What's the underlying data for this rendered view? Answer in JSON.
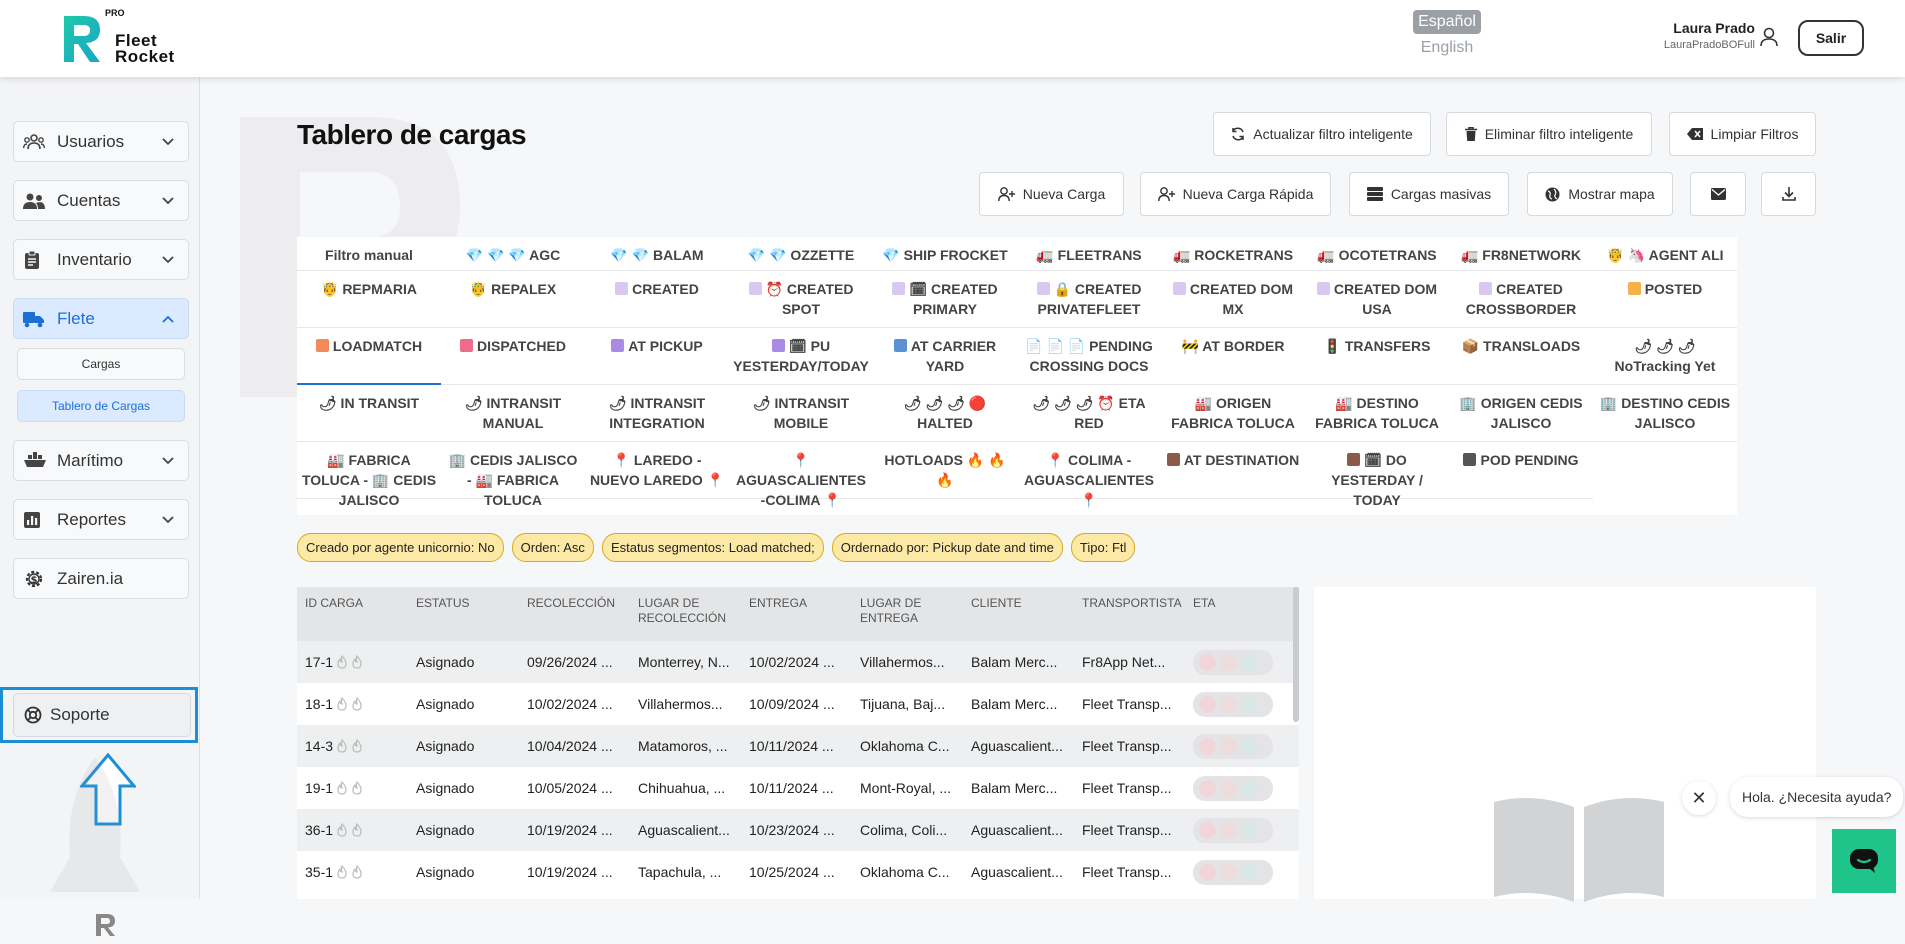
{
  "header": {
    "logo_pro": "PRO",
    "logo_line1": "Fleet",
    "logo_line2": "Rocket",
    "lang_active": "Español",
    "lang_other": "English",
    "user_name": "Laura Prado",
    "user_handle": "LauraPradoBOFull",
    "logout_label": "Salir"
  },
  "sidebar": {
    "items": [
      {
        "label": "Usuarios",
        "icon": "users-icon"
      },
      {
        "label": "Cuentas",
        "icon": "people-icon"
      },
      {
        "label": "Inventario",
        "icon": "clipboard-icon"
      },
      {
        "label": "Flete",
        "icon": "truck-icon"
      },
      {
        "label": "Marítimo",
        "icon": "ship-icon"
      },
      {
        "label": "Reportes",
        "icon": "chart-icon"
      },
      {
        "label": "Zairen.ia",
        "icon": "gear-dollar-icon"
      }
    ],
    "sub_items": [
      "Cargas",
      "Tablero de Cargas"
    ],
    "support_label": "Soporte"
  },
  "main": {
    "title": "Tablero de cargas",
    "buttons": {
      "refresh_filter": "Actualizar filtro inteligente",
      "delete_filter": "Eliminar filtro inteligente",
      "clear_filters": "Limpiar Filtros",
      "new_load": "Nueva Carga",
      "new_quick_load": "Nueva Carga Rápida",
      "bulk_loads": "Cargas masivas",
      "show_map": "Mostrar mapa"
    },
    "filter_rows": [
      [
        "Filtro manual",
        "💎 💎 💎 AGC",
        "💎 💎 BALAM",
        "💎 💎 OZZETTE",
        "💎 SHIP FROCKET",
        "🚛 FLEETRANS",
        "🚛 ROCKETRANS",
        "🚛 OCOTETRANS",
        "🚛 FR8NETWORK",
        "🤴 🦄 AGENT ALI"
      ],
      [
        "🤴 REPMARIA",
        "🤴 REPALEX",
        "▫ CREATED",
        "▫ ⏰ CREATED SPOT",
        "▫ 🗓 CREATED PRIMARY",
        "▫ 🔒 CREATED PRIVATEFLEET",
        "▫ CREATED DOM MX",
        "▫ CREATED DOM USA",
        "▫ CREATED CROSSBORDER",
        "▫ POSTED"
      ],
      [
        "▫ LOADMATCH",
        "▫ DISPATCHED",
        "▫ AT PICKUP",
        "▫ 🗓 PU YESTERDAY/TODAY",
        "▫ AT CARRIER YARD",
        "📄 📄 📄 PENDING CROSSING DOCS",
        "🚧 AT BORDER",
        "🚦 TRANSFERS",
        "📦 TRANSLOADS",
        "🌶 🌶 🌶 NoTracking Yet"
      ],
      [
        "🌶 IN TRANSIT",
        "🌶 INTRANSIT MANUAL",
        "🌶 INTRANSIT INTEGRATION",
        "🌶 INTRANSIT MOBILE",
        "🌶 🌶 🌶 🔴 HALTED",
        "🌶 🌶 🌶 ⏰ ETA RED",
        "🏭 ORIGEN FABRICA TOLUCA",
        "🏭 DESTINO FABRICA TOLUCA",
        "🏢 ORIGEN CEDIS JALISCO",
        "🏢 DESTINO CEDIS JALISCO"
      ],
      [
        "🏭 FABRICA TOLUCA - 🏢 CEDIS JALISCO",
        "🏢 CEDIS JALISCO - 🏭 FABRICA TOLUCA",
        "📍 LAREDO - NUEVO LAREDO 📍",
        "📍 AGUASCALIENTES -COLIMA 📍",
        "HOTLOADS 🔥 🔥 🔥",
        "📍 COLIMA - AGUASCALIENTES 📍",
        "▫ AT DESTINATION",
        "▫ 🗓 DO YESTERDAY / TODAY",
        "▫ POD PENDING"
      ]
    ],
    "status_colors": {
      "created": "#d9c8f0",
      "posted": "#f5b24a",
      "loadmatch": "#f28b5b",
      "dispatched": "#ee6b8a",
      "at_pickup": "#a98ae6",
      "pu_yesterday": "#a98ae6",
      "at_carrier_yard": "#5b8fd6",
      "at_destination": "#8a5a4a",
      "do_yesterday": "#8a5a4a",
      "pod_pending": "#555555"
    },
    "active_tags": [
      "Creado por agente unicornio: No",
      "Orden: Asc",
      "Estatus segmentos: Load matched;",
      "Ordernado por: Pickup date and time",
      "Tipo: Ftl"
    ],
    "table": {
      "columns": [
        "ID CARGA",
        "ESTATUS",
        "RECOLECCIÓN",
        "LUGAR DE RECOLECCIÓN",
        "ENTREGA",
        "LUGAR DE ENTREGA",
        "CLIENTE",
        "TRANSPORTISTA",
        "ETA"
      ],
      "rows": [
        [
          "17-1",
          "Asignado",
          "09/26/2024 ...",
          "Monterrey, N...",
          "10/02/2024 ...",
          "Villahermos...",
          "Balam Merc...",
          "Fr8App Net..."
        ],
        [
          "18-1",
          "Asignado",
          "10/02/2024 ...",
          "Villahermos...",
          "10/09/2024 ...",
          "Tijuana, Baj...",
          "Balam Merc...",
          "Fleet Transp..."
        ],
        [
          "14-3",
          "Asignado",
          "10/04/2024 ...",
          "Matamoros, ...",
          "10/11/2024 ...",
          "Oklahoma C...",
          "Aguascalient...",
          "Fleet Transp..."
        ],
        [
          "19-1",
          "Asignado",
          "10/05/2024 ...",
          "Chihuahua, ...",
          "10/11/2024 ...",
          "Mont-Royal, ...",
          "Balam Merc...",
          "Fleet Transp..."
        ],
        [
          "36-1",
          "Asignado",
          "10/19/2024 ...",
          "Aguascalient...",
          "10/23/2024 ...",
          "Colima, Coli...",
          "Aguascalient...",
          "Fleet Transp..."
        ],
        [
          "35-1",
          "Asignado",
          "10/19/2024 ...",
          "Tapachula, ...",
          "10/25/2024 ...",
          "Oklahoma C...",
          "Aguascalient...",
          "Fleet Transp..."
        ]
      ]
    }
  },
  "chat": {
    "greeting": "Hola. ¿Necesita ayuda?"
  }
}
